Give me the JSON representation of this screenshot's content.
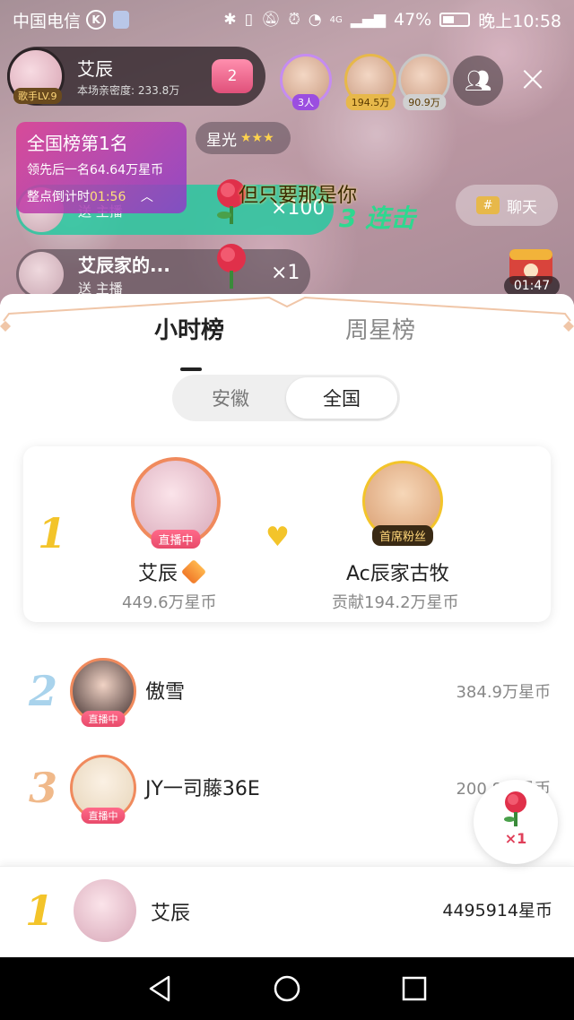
{
  "status_bar": {
    "carrier": "中国电信",
    "carrier_badge": "K",
    "network": "4G",
    "battery": "47%",
    "time": "晚上10:58"
  },
  "host": {
    "name": "艾辰",
    "level": "歌手LV.9",
    "intimacy": "本场亲密度: 233.8万",
    "heart_count": "2"
  },
  "viewers": [
    {
      "count": "3人"
    },
    {
      "count": "194.5万"
    },
    {
      "count": "90.9万"
    }
  ],
  "rank_card": {
    "title": "全国榜第1名",
    "lead": "领先后一名64.64万星币",
    "countdown_label": "整点倒计时",
    "countdown_time": "01:56"
  },
  "starlight": {
    "label": "星光",
    "stars": "★★★"
  },
  "gifts": [
    {
      "name": "",
      "action": "送 主播",
      "multiplier": "×100"
    },
    {
      "name": "艾辰家的...",
      "action": "送 主播",
      "multiplier": "×1"
    }
  ],
  "combo": "3 连击",
  "lyric": "但只要那是你",
  "chat_button": {
    "icon": "#",
    "label": "聊天"
  },
  "treasure_timer": "01:47",
  "sheet": {
    "tabs": [
      "小时榜",
      "周星榜"
    ],
    "regions": [
      "安徽",
      "全国"
    ],
    "top": {
      "rank": "1",
      "host_name": "艾辰",
      "host_live": "直播中",
      "host_coins": "449.6万星币",
      "fan_tag": "首席粉丝",
      "fan_name": "Ac辰家古牧",
      "fan_coins": "贡献194.2万星币"
    },
    "list": [
      {
        "rank": "2",
        "name": "傲雪",
        "live": "直播中",
        "coins": "384.9万星币"
      },
      {
        "rank": "3",
        "name": "JY一司藤36E",
        "live": "直播中",
        "coins": "200.8万星币"
      }
    ],
    "gift_fab": "×1",
    "mine": {
      "rank": "1",
      "name": "艾辰",
      "coins": "4495914星币"
    }
  },
  "colors": {
    "accent_gold": "#f3c42a",
    "live_pink": "#e84a6a",
    "combo_green": "#2ed88f",
    "rank_card_purple": "#8c3cc8"
  }
}
